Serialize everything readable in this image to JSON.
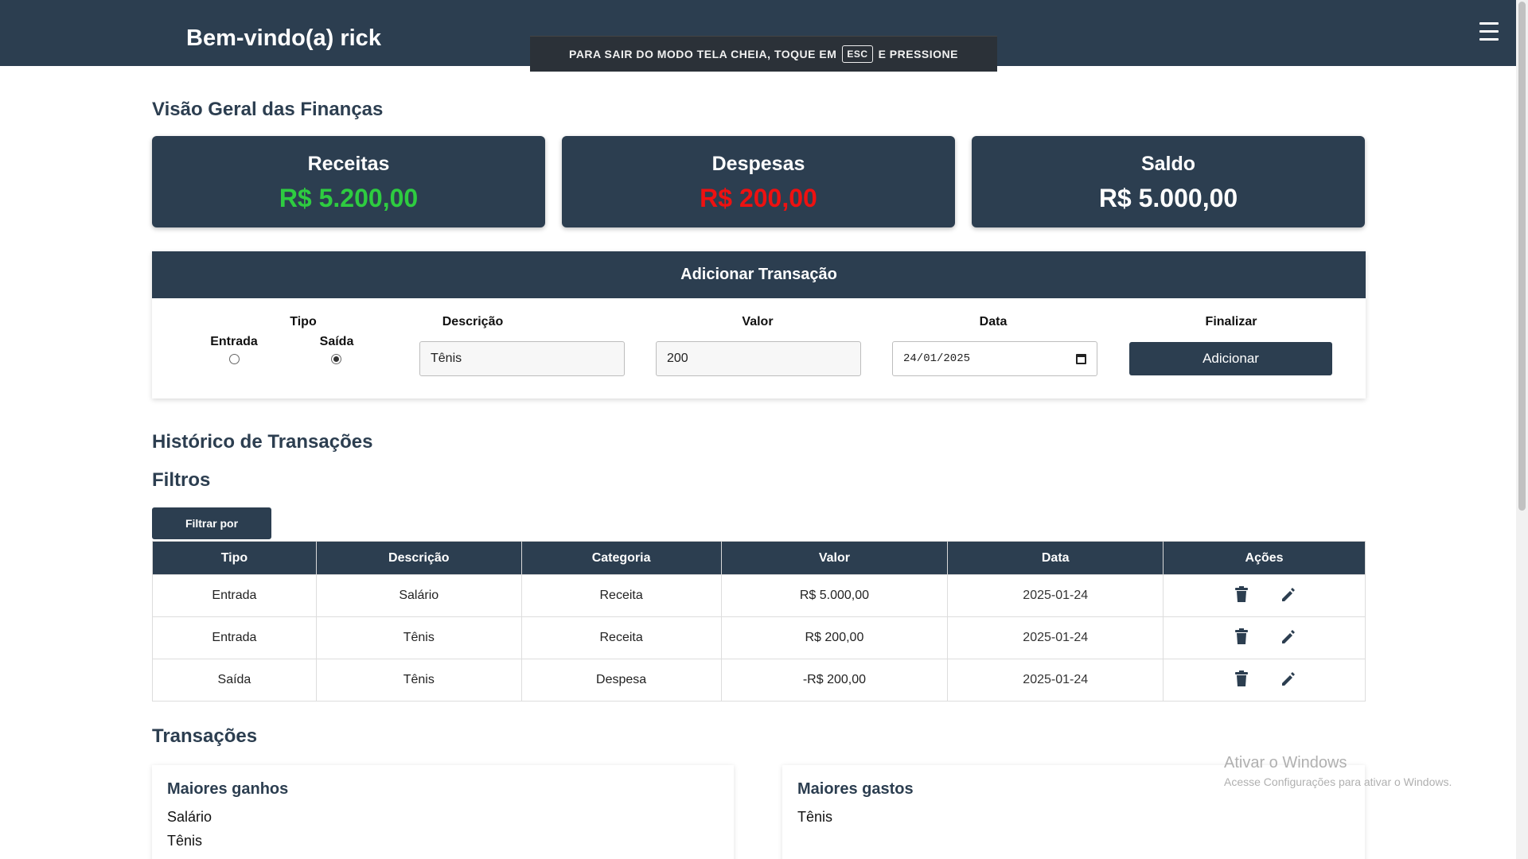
{
  "header": {
    "welcome": "Bem-vindo(a) rick"
  },
  "fullscreen_banner": {
    "before": "PARA SAIR DO MODO TELA CHEIA, TOQUE EM",
    "key": "ESC",
    "after": "E PRESSIONE"
  },
  "overview": {
    "title": "Visão Geral das Finanças",
    "cards": [
      {
        "label": "Receitas",
        "amount": "R$ 5.200,00",
        "color": "#2ecc40"
      },
      {
        "label": "Despesas",
        "amount": "R$ 200,00",
        "color": "#ee1111"
      },
      {
        "label": "Saldo",
        "amount": "R$ 5.000,00",
        "color": "#ffffff"
      }
    ]
  },
  "add_transaction": {
    "title": "Adicionar Transação",
    "type_label": "Tipo",
    "type_options": [
      "Entrada",
      "Saída"
    ],
    "type_selected": "Saída",
    "description_label": "Descrição",
    "description_value": "Tênis",
    "value_label": "Valor",
    "value_value": "200",
    "date_label": "Data",
    "date_value": "24/01/2025",
    "finalize_label": "Finalizar",
    "add_button": "Adicionar"
  },
  "history": {
    "title": "Histórico de Transações",
    "filters_title": "Filtros",
    "filter_button": "Filtrar por",
    "columns": [
      "Tipo",
      "Descrição",
      "Categoria",
      "Valor",
      "Data",
      "Ações"
    ],
    "rows": [
      {
        "tipo": "Entrada",
        "descricao": "Salário",
        "categoria": "Receita",
        "valor": "R$ 5.000,00",
        "data": "2025-01-24"
      },
      {
        "tipo": "Entrada",
        "descricao": "Tênis",
        "categoria": "Receita",
        "valor": "R$ 200,00",
        "data": "2025-01-24"
      },
      {
        "tipo": "Saída",
        "descricao": "Tênis",
        "categoria": "Despesa",
        "valor": "-R$ 200,00",
        "data": "2025-01-24"
      }
    ]
  },
  "transactions": {
    "title": "Transações",
    "top_gains_title": "Maiores ganhos",
    "top_gains": [
      "Salário",
      "Tênis"
    ],
    "top_expenses_title": "Maiores gastos",
    "top_expenses": [
      "Tênis"
    ]
  },
  "watermark": {
    "line1": "Ativar o Windows",
    "line2": "Acesse Configurações para ativar o Windows."
  }
}
